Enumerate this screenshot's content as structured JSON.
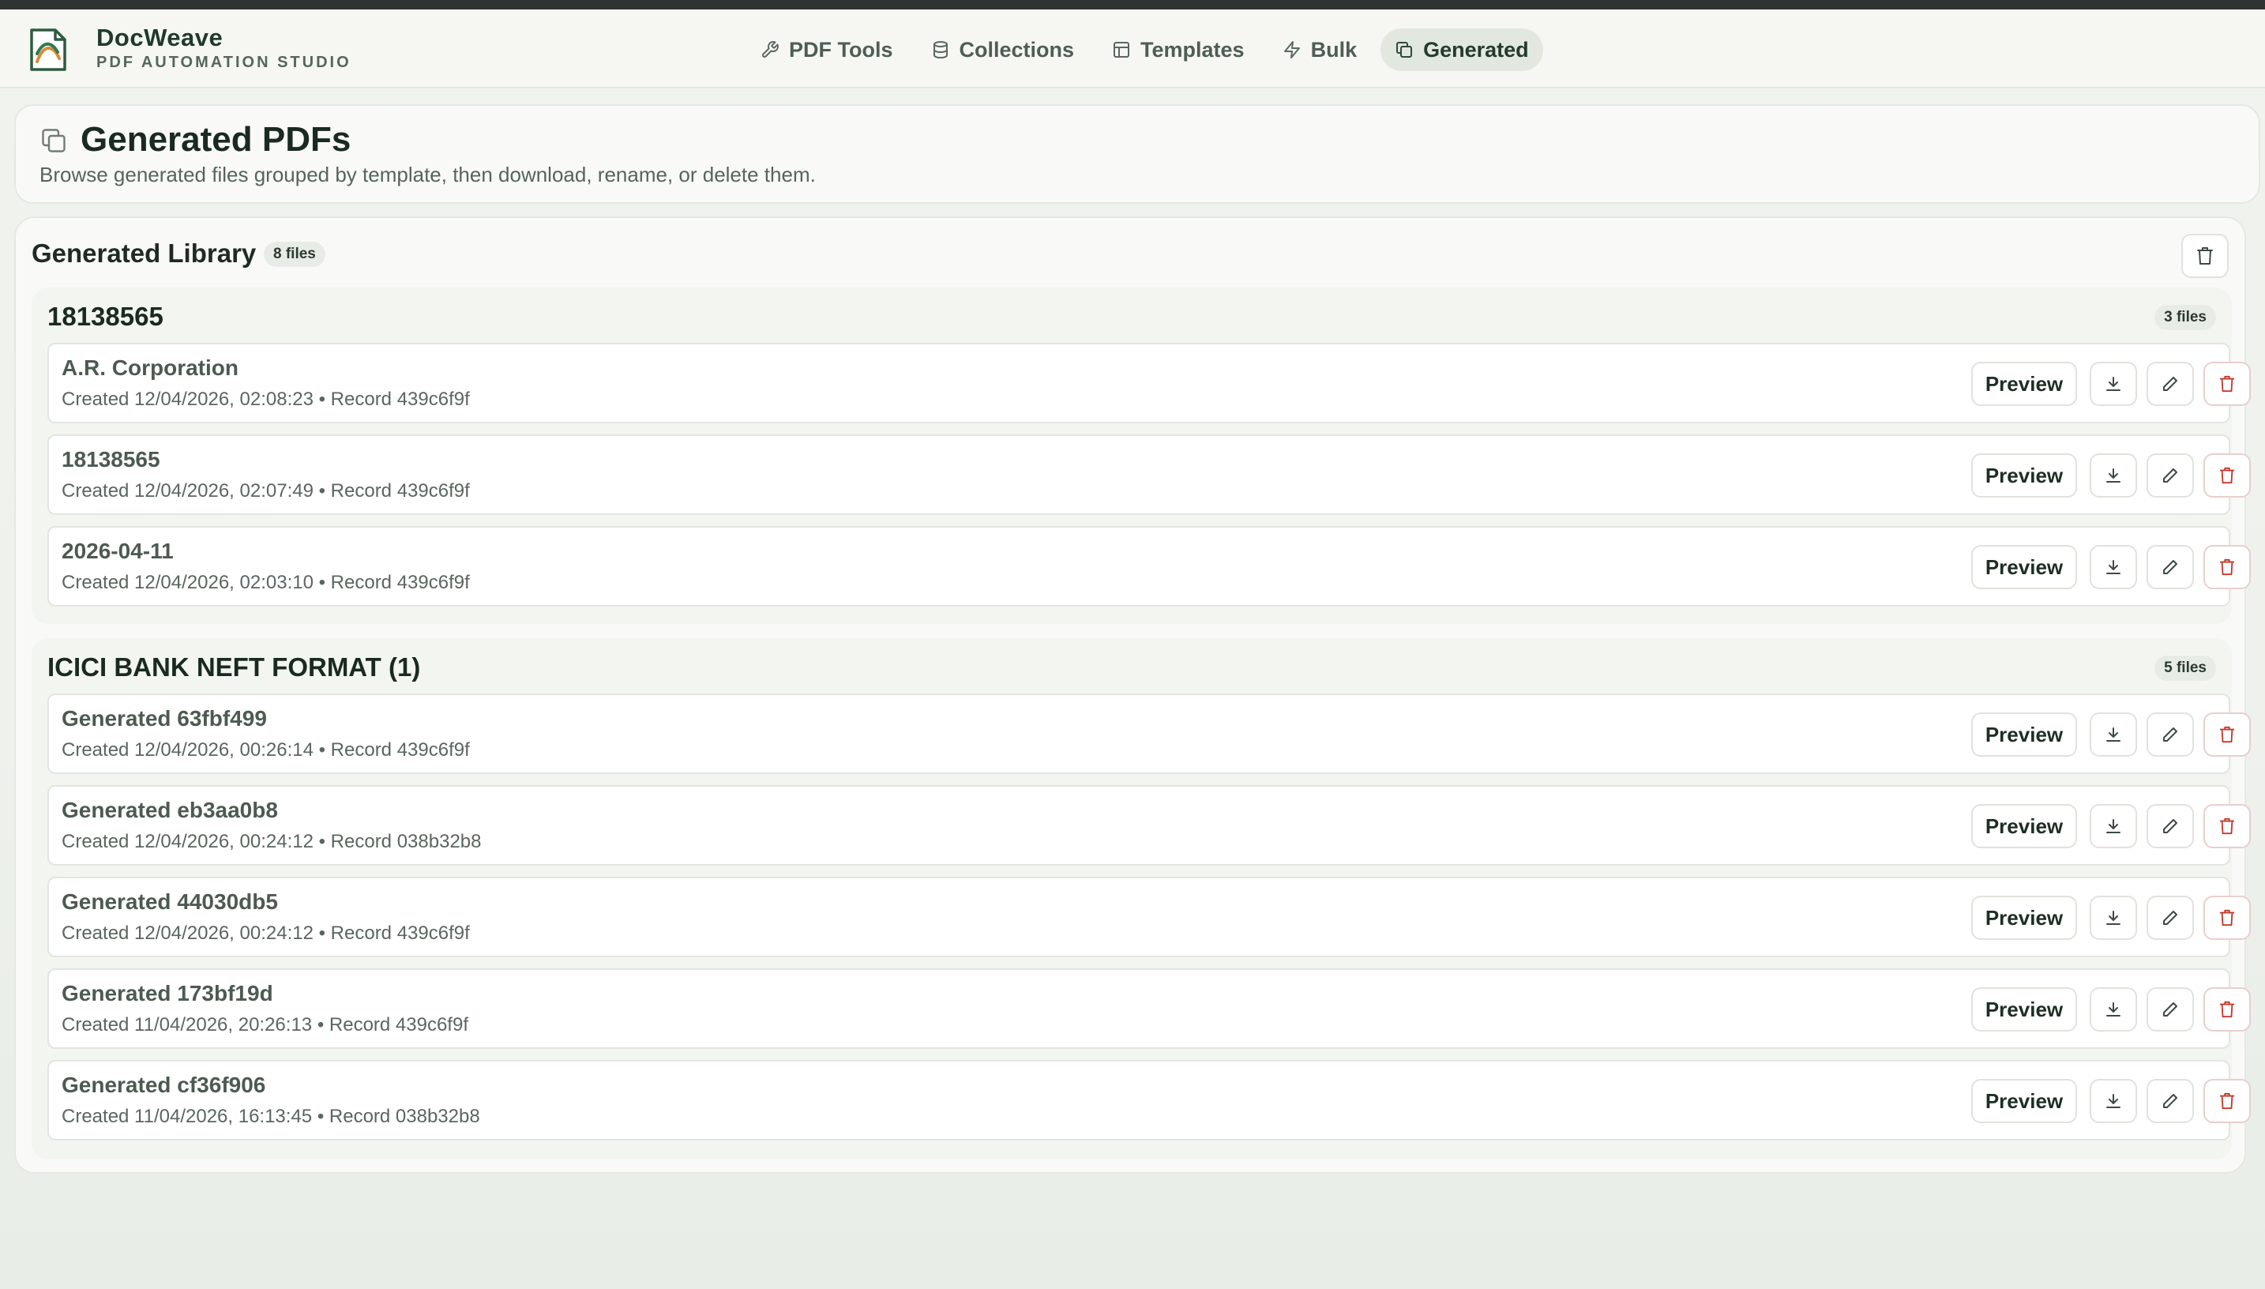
{
  "app": {
    "name": "DocWeave",
    "subtitle": "PDF AUTOMATION STUDIO"
  },
  "nav": [
    {
      "label": "PDF Tools",
      "icon": "wrench-icon"
    },
    {
      "label": "Collections",
      "icon": "database-icon"
    },
    {
      "label": "Templates",
      "icon": "template-icon"
    },
    {
      "label": "Bulk",
      "icon": "lightning-icon"
    },
    {
      "label": "Generated",
      "icon": "copy-icon",
      "active": true
    }
  ],
  "hero": {
    "title": "Generated PDFs",
    "description": "Browse generated files grouped by template, then download, rename, or delete them."
  },
  "library": {
    "title": "Generated Library",
    "count": "8 files",
    "groups": [
      {
        "title": "18138565",
        "count": "3 files",
        "files": [
          {
            "name": "A.R. Corporation",
            "meta": "Created 12/04/2026, 02:08:23 • Record 439c6f9f"
          },
          {
            "name": "18138565",
            "meta": "Created 12/04/2026, 02:07:49 • Record 439c6f9f"
          },
          {
            "name": "2026-04-11",
            "meta": "Created 12/04/2026, 02:03:10 • Record 439c6f9f"
          }
        ]
      },
      {
        "title": "ICICI BANK NEFT FORMAT (1)",
        "count": "5 files",
        "files": [
          {
            "name": "Generated 63fbf499",
            "meta": "Created 12/04/2026, 00:26:14 • Record 439c6f9f"
          },
          {
            "name": "Generated eb3aa0b8",
            "meta": "Created 12/04/2026, 00:24:12 • Record 038b32b8"
          },
          {
            "name": "Generated 44030db5",
            "meta": "Created 12/04/2026, 00:24:12 • Record 439c6f9f"
          },
          {
            "name": "Generated 173bf19d",
            "meta": "Created 11/04/2026, 20:26:13 • Record 439c6f9f"
          },
          {
            "name": "Generated cf36f906",
            "meta": "Created 11/04/2026, 16:13:45 • Record 038b32b8"
          }
        ]
      }
    ]
  },
  "actions": {
    "preview_label": "Preview"
  },
  "colors": {
    "accent": "#2f6b45",
    "danger": "#c0392b",
    "background": "#eef1ec"
  }
}
